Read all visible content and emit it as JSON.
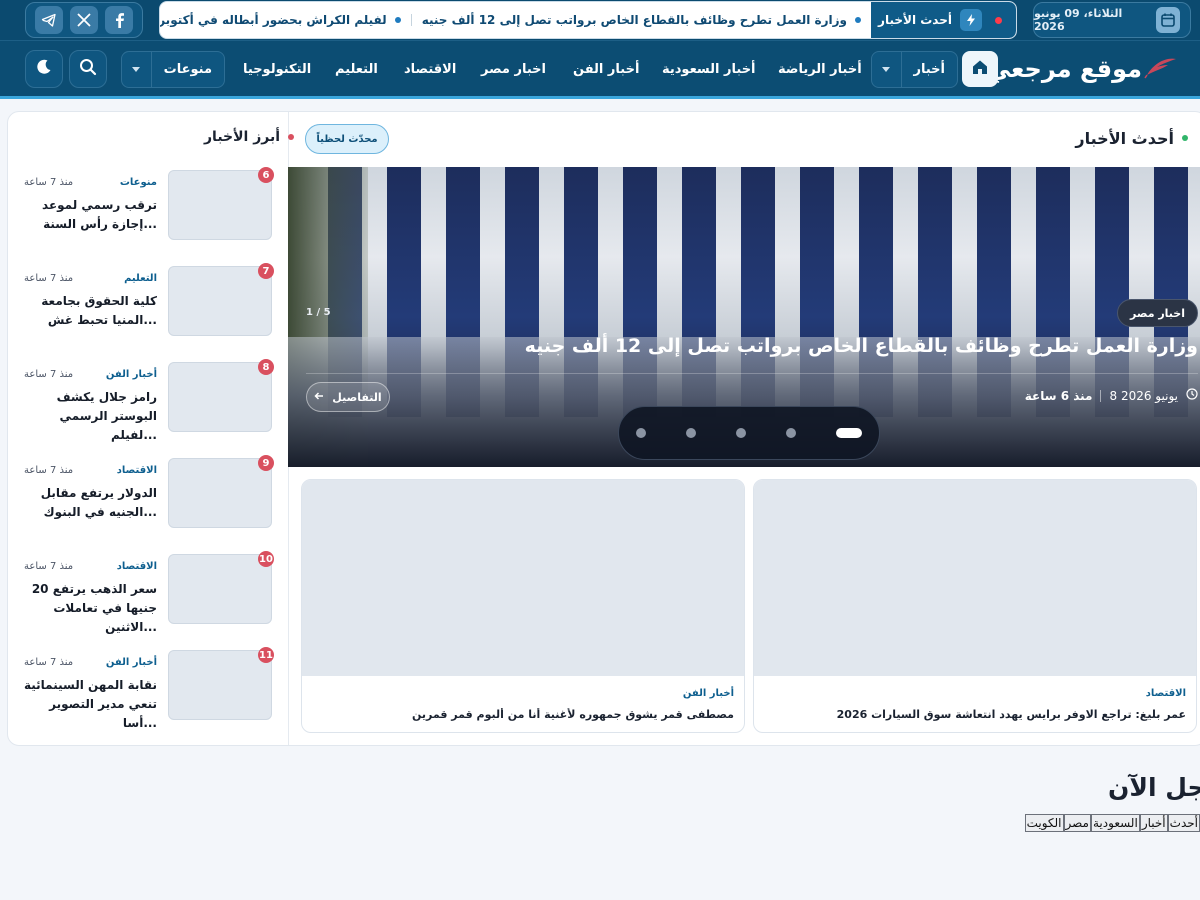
{
  "topbar": {
    "date": "الثلاثاء، 09 يونيو 2026",
    "ticker_label": "أحدث الأخبار",
    "ticker_items": [
      "وزارة العمل تطرح وظائف بالقطاع الخاص برواتب تصل إلى 12 ألف جنيه",
      "لفيلم الكراش بحضور أبطاله في أكتوبر"
    ],
    "socials": [
      "facebook-icon",
      "x-icon",
      "telegram-icon"
    ]
  },
  "nav": {
    "logo": "موقع مرجعي",
    "news_dropdown": "أخبار",
    "links": [
      "أخبار الرياضة",
      "أخبار السعودية",
      "أخبار الفن",
      "اخبار مصر",
      "الاقتصاد",
      "التعليم",
      "التكنولوجيا"
    ],
    "misc_dropdown": "منوعات"
  },
  "latest": {
    "title": "أحدث الأخبار",
    "live_badge": "محدّث لحظياً",
    "hero": {
      "category": "اخبار مصر",
      "counter": "1 / 5",
      "title": "وزارة العمل تطرح وظائف بالقطاع الخاص برواتب تصل إلى 12 ألف جنيه",
      "date": "8 يونيو 2026",
      "ago": "منذ 6 ساعة",
      "details": "التفاصيل",
      "slides": 5,
      "active_slide": 1
    },
    "cards": [
      {
        "category": "الاقتصاد",
        "title": "عمر بليغ: تراجع الاوفر برايس يهدد انتعاشة سوق السيارات 2026"
      },
      {
        "category": "أخبار الفن",
        "title": "مصطفى قمر يشوق جمهوره لأغنية أنا من ألبوم قمر قمرين"
      }
    ]
  },
  "top_news": {
    "title": "أبرز الأخبار",
    "items": [
      {
        "num": "6",
        "category": "منوعات",
        "time": "منذ 7 ساعة",
        "title": "ترقب رسمي لموعد إجازة رأس السنة..."
      },
      {
        "num": "7",
        "category": "التعليم",
        "time": "منذ 7 ساعة",
        "title": "كلية الحقوق بجامعة المنيا تحبط غش..."
      },
      {
        "num": "8",
        "category": "أخبار الفن",
        "time": "منذ 7 ساعة",
        "title": "رامز جلال يكشف البوستر الرسمي لفيلم..."
      },
      {
        "num": "9",
        "category": "الاقتصاد",
        "time": "منذ 7 ساعة",
        "title": "الدولار يرتفع مقابل الجنيه في البنوك..."
      },
      {
        "num": "10",
        "category": "الاقتصاد",
        "time": "منذ 7 ساعة",
        "title": "سعر الذهب يرتفع 20 جنيها في تعاملات الاثنين..."
      },
      {
        "num": "11",
        "category": "أخبار الفن",
        "time": "منذ 7 ساعة",
        "title": "نقابة المهن السينمائية تنعي مدير التصوير أسا..."
      }
    ]
  },
  "urgent": {
    "title": "عاجل الآن",
    "tabs": [
      "أحدث",
      "أخبار",
      "السعودية",
      "مصر",
      "الكويت"
    ]
  },
  "colors": {
    "brand": "#0c4d73",
    "accent": "#3aa6dc",
    "badge": "#d9505f"
  }
}
